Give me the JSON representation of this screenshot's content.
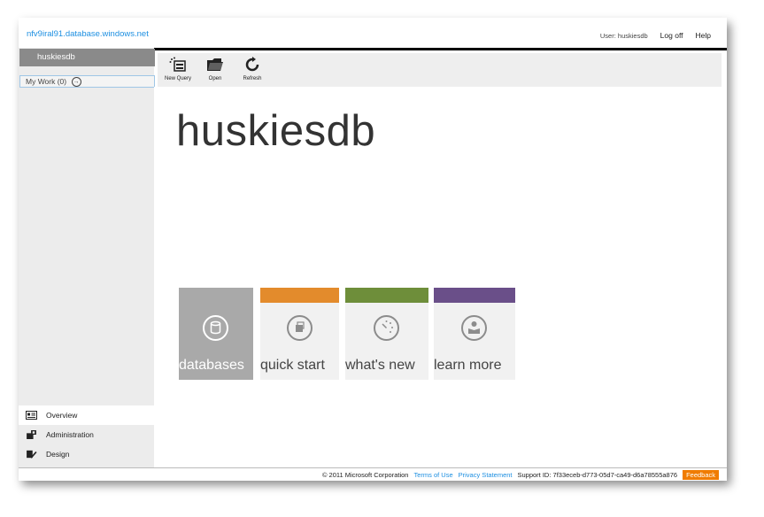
{
  "header": {
    "server": "nfv9iral91.database.windows.net",
    "user": "User: huskiesdb",
    "logoff": "Log off",
    "help": "Help"
  },
  "sidebar": {
    "db_name": "huskiesdb",
    "my_work": "My Work (0)",
    "nav": [
      {
        "label": "Overview"
      },
      {
        "label": "Administration"
      },
      {
        "label": "Design"
      }
    ]
  },
  "toolbar": {
    "items": [
      {
        "label": "New Query",
        "icon": "new-query-icon"
      },
      {
        "label": "Open",
        "icon": "folder-icon"
      },
      {
        "label": "Refresh",
        "icon": "refresh-icon"
      }
    ]
  },
  "main": {
    "title": "huskiesdb",
    "tiles": [
      {
        "label": "databases",
        "color": "#a9a9a9",
        "icon": "database-icon"
      },
      {
        "label": "quick start",
        "color": "#e38b2c",
        "icon": "quick-start-icon"
      },
      {
        "label": "what's new",
        "color": "#6e8e3a",
        "icon": "dial-icon"
      },
      {
        "label": "learn more",
        "color": "#6a4f89",
        "icon": "reader-icon"
      }
    ]
  },
  "footer": {
    "copyright": "© 2011 Microsoft Corporation",
    "terms": "Terms of Use",
    "privacy": "Privacy Statement",
    "support": "Support ID:  7f33eceb-d773-05d7-ca49-d6a78555a876",
    "feedback": "Feedback"
  },
  "colors": {
    "accent_blue": "#1d8fe1",
    "feedback_orange": "#f07c00"
  }
}
